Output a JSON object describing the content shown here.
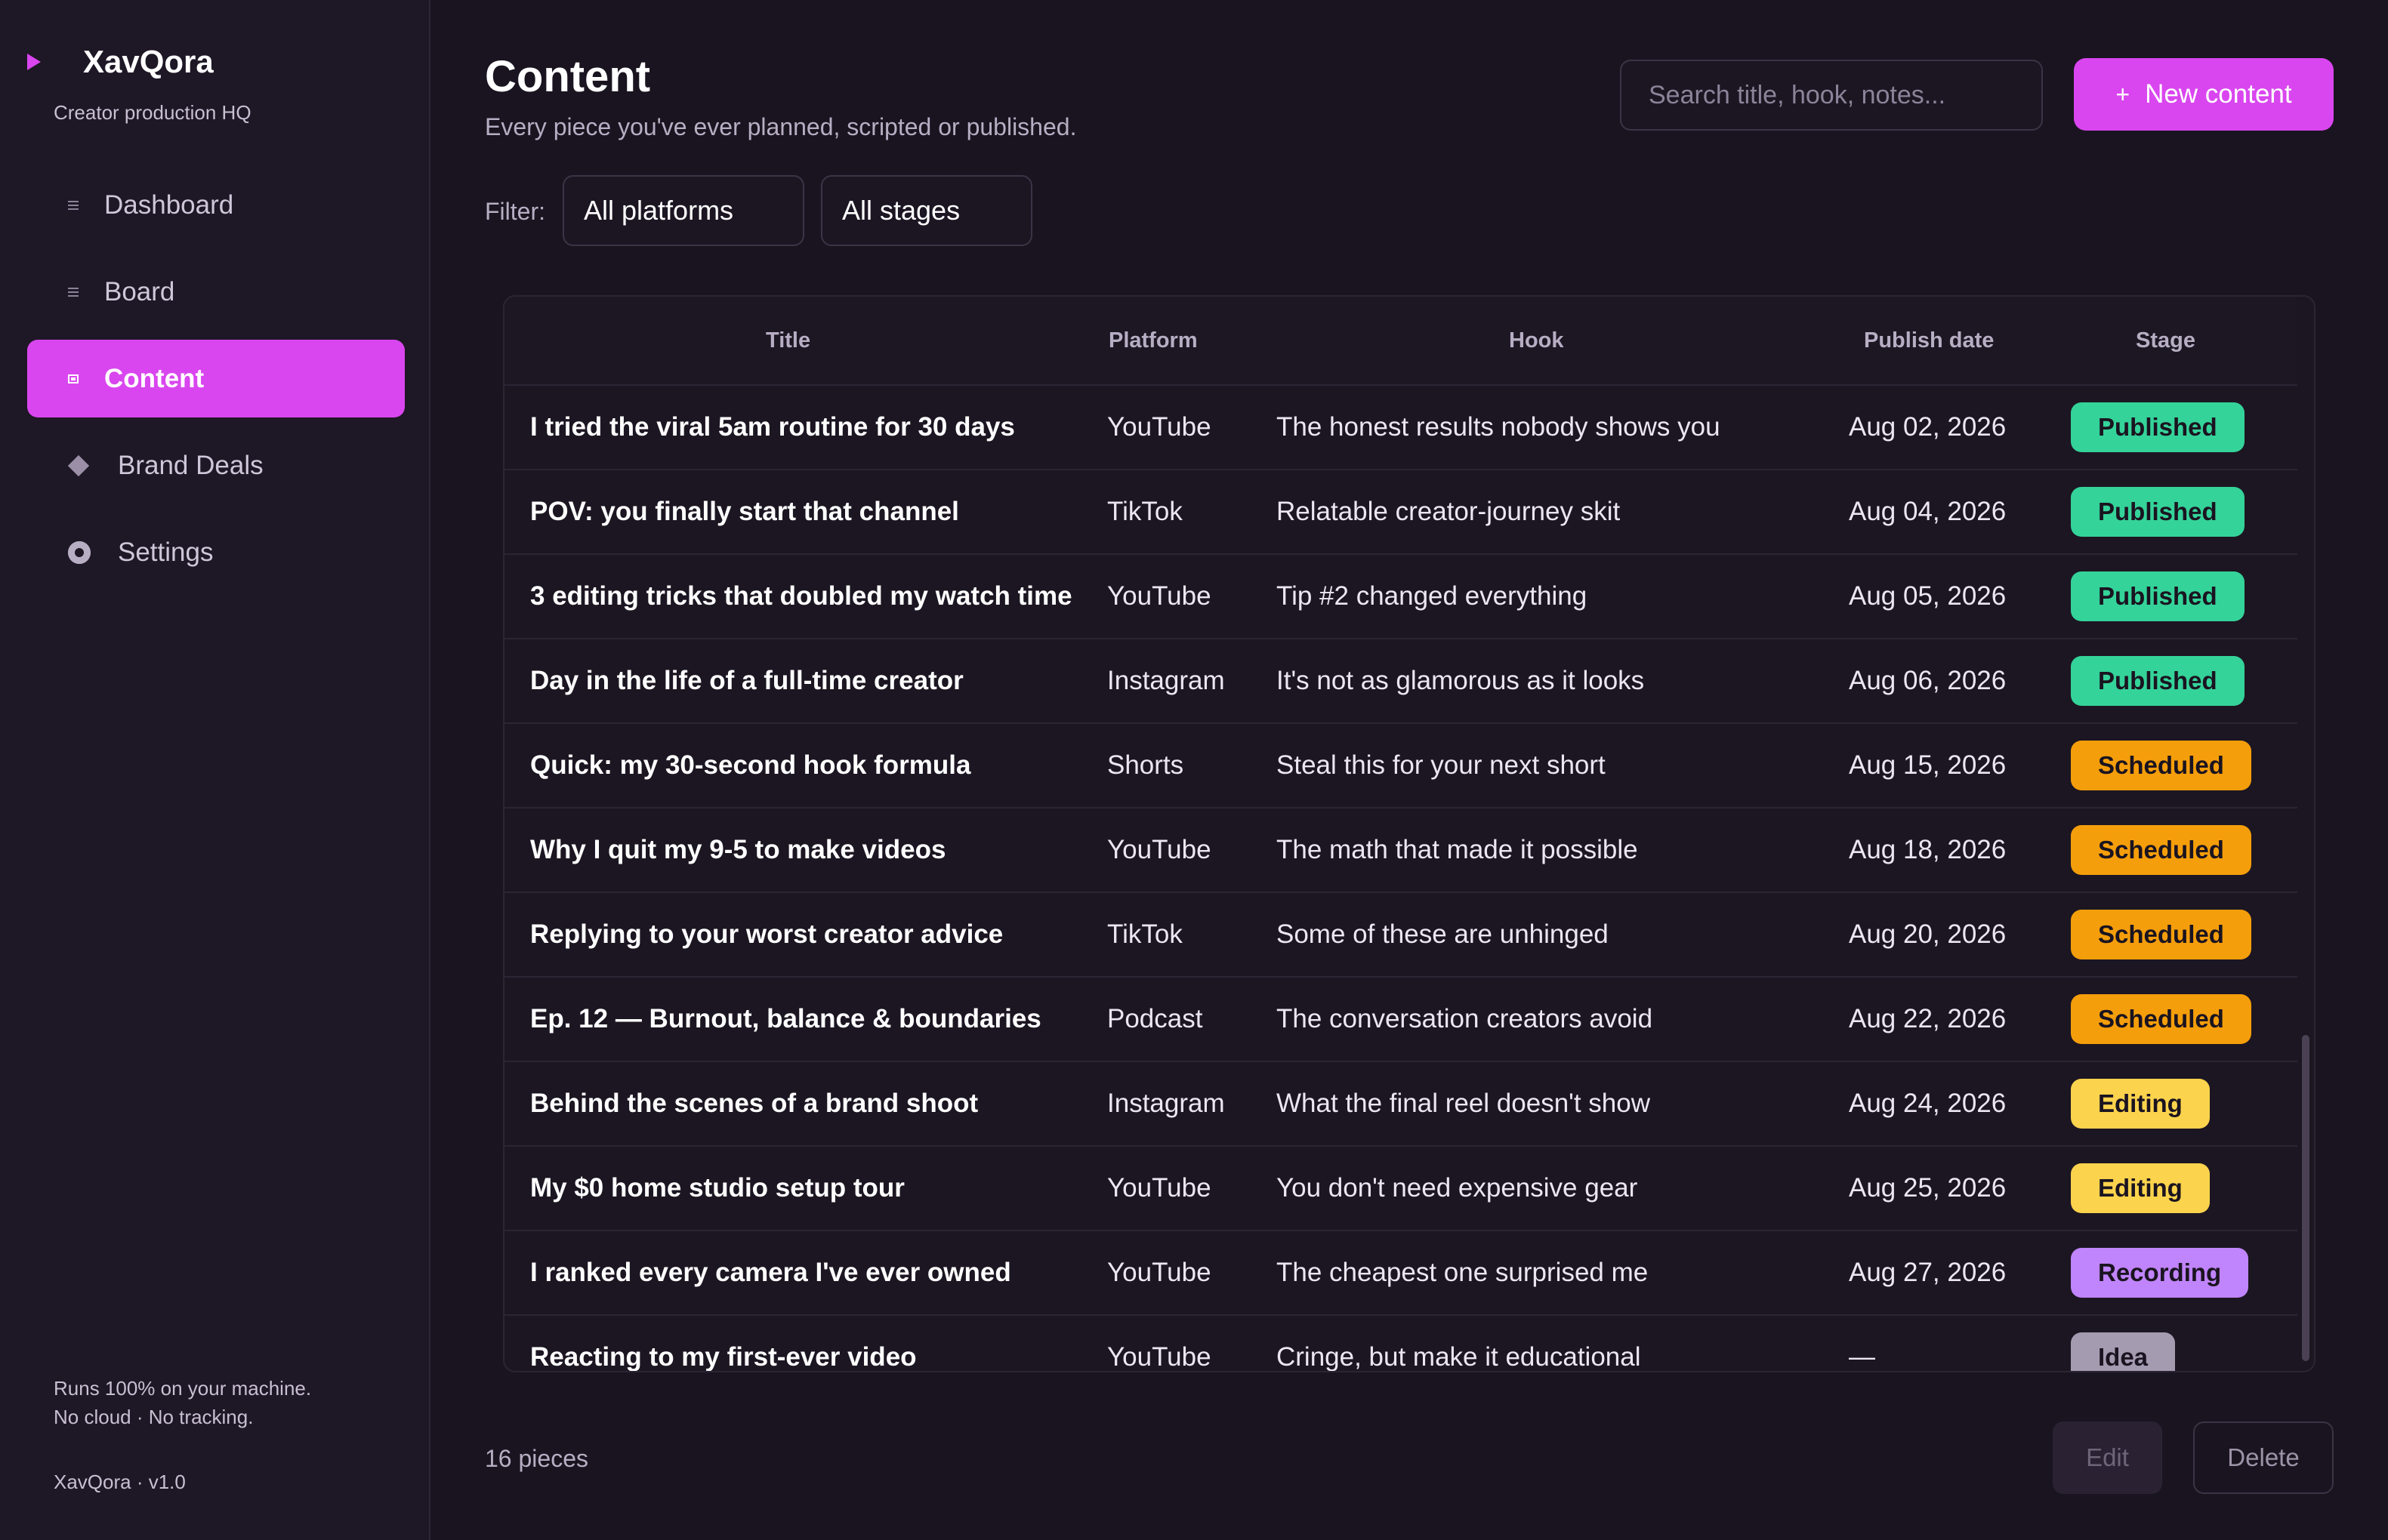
{
  "sidebar": {
    "brand": "XavQora",
    "tagline": "Creator production HQ",
    "items": [
      {
        "label": "Dashboard",
        "icon": "dashboard-icon",
        "active": false
      },
      {
        "label": "Board",
        "icon": "board-icon",
        "active": false
      },
      {
        "label": "Content",
        "icon": "content-icon",
        "active": true
      },
      {
        "label": "Brand Deals",
        "icon": "diamond-icon",
        "active": false
      },
      {
        "label": "Settings",
        "icon": "gear-icon",
        "active": false
      }
    ],
    "footer_line1": "Runs 100% on your machine.",
    "footer_line2": "No cloud · No tracking.",
    "version": "XavQora · v1.0"
  },
  "header": {
    "title": "Content",
    "subtitle": "Every piece you've ever planned, scripted or published.",
    "search_placeholder": "Search title, hook, notes...",
    "new_button": "New content",
    "new_button_icon": "+"
  },
  "filters": {
    "label": "Filter:",
    "platform": "All platforms",
    "stage": "All stages"
  },
  "table": {
    "columns": [
      "Title",
      "Platform",
      "Hook",
      "Publish date",
      "Stage"
    ],
    "rows": [
      {
        "title": "I tried the viral 5am routine for 30 days",
        "platform": "YouTube",
        "hook": "The honest results nobody shows you",
        "date": "Aug 02, 2026",
        "stage": "Published"
      },
      {
        "title": "POV: you finally start that channel",
        "platform": "TikTok",
        "hook": "Relatable creator-journey skit",
        "date": "Aug 04, 2026",
        "stage": "Published"
      },
      {
        "title": "3 editing tricks that doubled my watch time",
        "platform": "YouTube",
        "hook": "Tip #2 changed everything",
        "date": "Aug 05, 2026",
        "stage": "Published"
      },
      {
        "title": "Day in the life of a full-time creator",
        "platform": "Instagram",
        "hook": "It's not as glamorous as it looks",
        "date": "Aug 06, 2026",
        "stage": "Published"
      },
      {
        "title": "Quick: my 30-second hook formula",
        "platform": "Shorts",
        "hook": "Steal this for your next short",
        "date": "Aug 15, 2026",
        "stage": "Scheduled"
      },
      {
        "title": "Why I quit my 9-5 to make videos",
        "platform": "YouTube",
        "hook": "The math that made it possible",
        "date": "Aug 18, 2026",
        "stage": "Scheduled"
      },
      {
        "title": "Replying to your worst creator advice",
        "platform": "TikTok",
        "hook": "Some of these are unhinged",
        "date": "Aug 20, 2026",
        "stage": "Scheduled"
      },
      {
        "title": "Ep. 12 — Burnout, balance & boundaries",
        "platform": "Podcast",
        "hook": "The conversation creators avoid",
        "date": "Aug 22, 2026",
        "stage": "Scheduled"
      },
      {
        "title": "Behind the scenes of a brand shoot",
        "platform": "Instagram",
        "hook": "What the final reel doesn't show",
        "date": "Aug 24, 2026",
        "stage": "Editing"
      },
      {
        "title": "My $0 home studio setup tour",
        "platform": "YouTube",
        "hook": "You don't need expensive gear",
        "date": "Aug 25, 2026",
        "stage": "Editing"
      },
      {
        "title": "I ranked every camera I've ever owned",
        "platform": "YouTube",
        "hook": "The cheapest one surprised me",
        "date": "Aug 27, 2026",
        "stage": "Recording"
      },
      {
        "title": "Reacting to my first-ever video",
        "platform": "YouTube",
        "hook": "Cringe, but make it educational",
        "date": "—",
        "stage": "Idea"
      }
    ]
  },
  "stage_colors": {
    "Published": "#34d399",
    "Scheduled": "#f59e0b",
    "Editing": "#fcd34d",
    "Recording": "#c084fc",
    "Idea": "#a59bb1"
  },
  "footer": {
    "count": "16 pieces",
    "edit_label": "Edit",
    "delete_label": "Delete"
  }
}
